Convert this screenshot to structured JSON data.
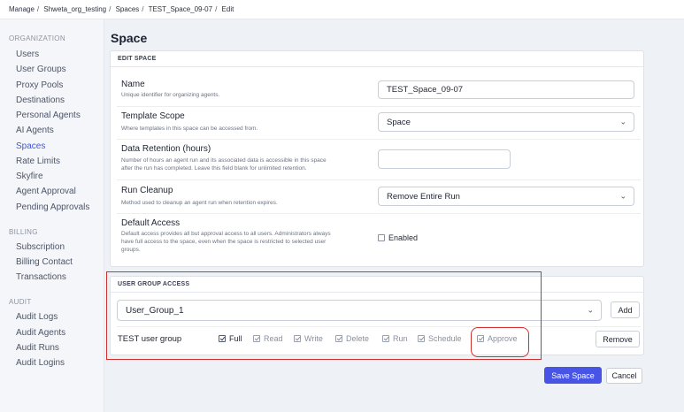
{
  "breadcrumb": [
    "Manage",
    "Shweta_org_testing",
    "Spaces",
    "TEST_Space_09-07",
    "Edit"
  ],
  "sidebar": {
    "sections": [
      {
        "label": "ORGANIZATION",
        "items": [
          "Users",
          "User Groups",
          "Proxy Pools",
          "Destinations",
          "Personal Agents",
          "AI Agents",
          "Spaces",
          "Rate Limits",
          "Skyfire",
          "Agent Approval",
          "Pending Approvals"
        ]
      },
      {
        "label": "BILLING",
        "items": [
          "Subscription",
          "Billing Contact",
          "Transactions"
        ]
      },
      {
        "label": "AUDIT",
        "items": [
          "Audit Logs",
          "Audit Agents",
          "Audit Runs",
          "Audit Logins"
        ]
      }
    ],
    "active_item": "Spaces"
  },
  "page": {
    "title": "Space"
  },
  "edit_space": {
    "heading": "EDIT SPACE",
    "name": {
      "label": "Name",
      "desc": "Unique identifier for organizing agents.",
      "value": "TEST_Space_09-07"
    },
    "template_scope": {
      "label": "Template Scope",
      "desc": "Where templates in this space can be accessed from.",
      "value": "Space"
    },
    "data_retention": {
      "label": "Data Retention (hours)",
      "desc_1": "Number of hours an agent run and its associated data is accessible in this space",
      "desc_2": "after the run has completed. Leave this field blank for unlimited retention.",
      "value": ""
    },
    "run_cleanup": {
      "label": "Run Cleanup",
      "desc": "Method used to cleanup an agent run when retention expires.",
      "value": "Remove Entire Run"
    },
    "default_access": {
      "label": "Default Access",
      "desc_1": "Default access provides all but approval access to all users. Administrators always",
      "desc_2": "have full access to the space, even when the space is restricted to selected user",
      "desc_3": "groups.",
      "checkbox_label": "Enabled",
      "checked": false
    }
  },
  "user_group_access": {
    "heading": "USER GROUP ACCESS",
    "selected_group": "User_Group_1",
    "add_label": "Add",
    "group_name": "TEST user group",
    "permissions": [
      {
        "label": "Full",
        "checked": true
      },
      {
        "label": "Read",
        "checked": true
      },
      {
        "label": "Write",
        "checked": true
      },
      {
        "label": "Delete",
        "checked": true
      },
      {
        "label": "Run",
        "checked": true
      },
      {
        "label": "Schedule",
        "checked": true
      },
      {
        "label": "Approve",
        "checked": true
      }
    ],
    "remove_label": "Remove"
  },
  "actions": {
    "save_label": "Save Space",
    "cancel_label": "Cancel"
  },
  "colors": {
    "accent": "#4754e6",
    "active_nav": "#3e55e8",
    "highlight": "#d0312d"
  }
}
